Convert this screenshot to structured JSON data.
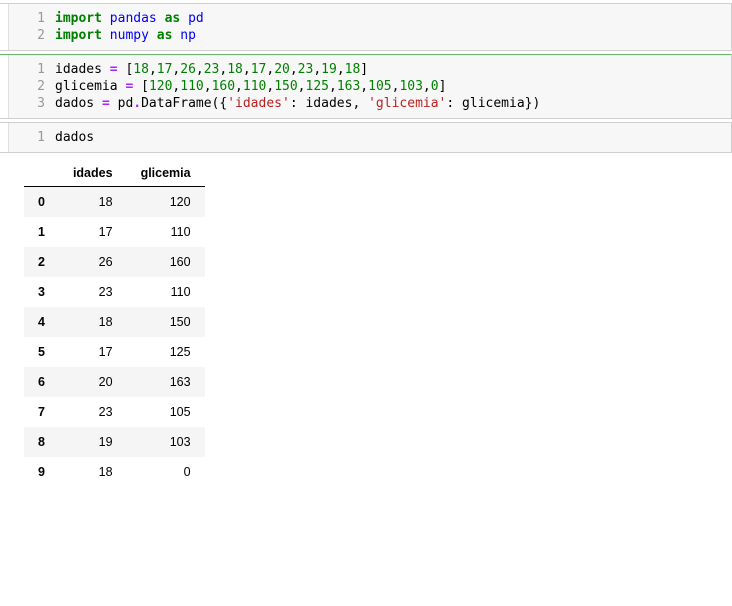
{
  "cells": {
    "c1": {
      "lines": [
        {
          "n": "1",
          "tokens": [
            {
              "t": "import",
              "c": "kw"
            },
            {
              "t": " "
            },
            {
              "t": "pandas",
              "c": "nn"
            },
            {
              "t": " "
            },
            {
              "t": "as",
              "c": "kw"
            },
            {
              "t": " "
            },
            {
              "t": "pd",
              "c": "nn"
            }
          ]
        },
        {
          "n": "2",
          "tokens": [
            {
              "t": "import",
              "c": "kw"
            },
            {
              "t": " "
            },
            {
              "t": "numpy",
              "c": "nn"
            },
            {
              "t": " "
            },
            {
              "t": "as",
              "c": "kw"
            },
            {
              "t": " "
            },
            {
              "t": "np",
              "c": "nn"
            }
          ]
        }
      ]
    },
    "c2": {
      "lines": [
        {
          "n": "1",
          "tokens": [
            {
              "t": "idades "
            },
            {
              "t": "=",
              "c": "op"
            },
            {
              "t": " ["
            },
            {
              "t": "18",
              "c": "num"
            },
            {
              "t": ","
            },
            {
              "t": "17",
              "c": "num"
            },
            {
              "t": ","
            },
            {
              "t": "26",
              "c": "num"
            },
            {
              "t": ","
            },
            {
              "t": "23",
              "c": "num"
            },
            {
              "t": ","
            },
            {
              "t": "18",
              "c": "num"
            },
            {
              "t": ","
            },
            {
              "t": "17",
              "c": "num"
            },
            {
              "t": ","
            },
            {
              "t": "20",
              "c": "num"
            },
            {
              "t": ","
            },
            {
              "t": "23",
              "c": "num"
            },
            {
              "t": ","
            },
            {
              "t": "19",
              "c": "num"
            },
            {
              "t": ","
            },
            {
              "t": "18",
              "c": "num"
            },
            {
              "t": "]"
            }
          ]
        },
        {
          "n": "2",
          "tokens": [
            {
              "t": "glicemia "
            },
            {
              "t": "=",
              "c": "op"
            },
            {
              "t": " ["
            },
            {
              "t": "120",
              "c": "num"
            },
            {
              "t": ","
            },
            {
              "t": "110",
              "c": "num"
            },
            {
              "t": ","
            },
            {
              "t": "160",
              "c": "num"
            },
            {
              "t": ","
            },
            {
              "t": "110",
              "c": "num"
            },
            {
              "t": ","
            },
            {
              "t": "150",
              "c": "num"
            },
            {
              "t": ","
            },
            {
              "t": "125",
              "c": "num"
            },
            {
              "t": ","
            },
            {
              "t": "163",
              "c": "num"
            },
            {
              "t": ","
            },
            {
              "t": "105",
              "c": "num"
            },
            {
              "t": ","
            },
            {
              "t": "103",
              "c": "num"
            },
            {
              "t": ","
            },
            {
              "t": "0",
              "c": "num"
            },
            {
              "t": "]"
            }
          ]
        },
        {
          "n": "3",
          "tokens": [
            {
              "t": "dados "
            },
            {
              "t": "=",
              "c": "op"
            },
            {
              "t": " pd"
            },
            {
              "t": ".",
              "c": "op"
            },
            {
              "t": "DataFrame({"
            },
            {
              "t": "'idades'",
              "c": "str"
            },
            {
              "t": ": idades, "
            },
            {
              "t": "'glicemia'",
              "c": "str"
            },
            {
              "t": ": glicemia})"
            }
          ]
        }
      ]
    },
    "c3": {
      "lines": [
        {
          "n": "1",
          "tokens": [
            {
              "t": "dados"
            }
          ]
        }
      ]
    }
  },
  "output": {
    "columns": [
      "",
      "idades",
      "glicemia"
    ],
    "rows": [
      {
        "idx": "0",
        "idades": "18",
        "glicemia": "120"
      },
      {
        "idx": "1",
        "idades": "17",
        "glicemia": "110"
      },
      {
        "idx": "2",
        "idades": "26",
        "glicemia": "160"
      },
      {
        "idx": "3",
        "idades": "23",
        "glicemia": "110"
      },
      {
        "idx": "4",
        "idades": "18",
        "glicemia": "150"
      },
      {
        "idx": "5",
        "idades": "17",
        "glicemia": "125"
      },
      {
        "idx": "6",
        "idades": "20",
        "glicemia": "163"
      },
      {
        "idx": "7",
        "idades": "23",
        "glicemia": "105"
      },
      {
        "idx": "8",
        "idades": "19",
        "glicemia": "103"
      },
      {
        "idx": "9",
        "idades": "18",
        "glicemia": "0"
      }
    ]
  }
}
